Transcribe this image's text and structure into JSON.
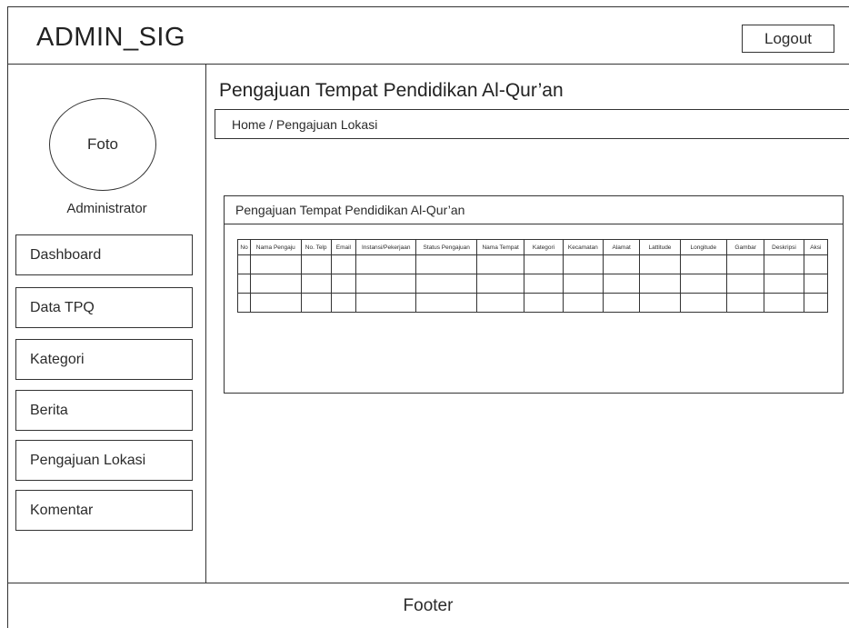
{
  "header": {
    "app_title": "ADMIN_SIG",
    "logout_label": "Logout"
  },
  "sidebar": {
    "avatar_label": "Foto",
    "role": "Administrator",
    "items": [
      {
        "label": "Dashboard"
      },
      {
        "label": "Data TPQ"
      },
      {
        "label": "Kategori"
      },
      {
        "label": "Berita"
      },
      {
        "label": "Pengajuan Lokasi"
      },
      {
        "label": "Komentar"
      }
    ]
  },
  "main": {
    "page_title": "Pengajuan Tempat Pendidikan Al-Qur’an",
    "breadcrumb": "Home / Pengajuan Lokasi",
    "panel_title": "Pengajuan Tempat Pendidikan Al-Qur’an",
    "table": {
      "columns": [
        "No",
        "Nama Pengaju",
        "No. Telp",
        "Email",
        "Instansi/Pekerjaan",
        "Status Pengajuan",
        "Nama Tempat",
        "Kategori",
        "Kecamatan",
        "Alamat",
        "Lattitude",
        "Longitude",
        "Gambar",
        "Deskripsi",
        "Aksi"
      ],
      "rows": [
        [
          "",
          "",
          "",
          "",
          "",
          "",
          "",
          "",
          "",
          "",
          "",
          "",
          "",
          "",
          ""
        ],
        [
          "",
          "",
          "",
          "",
          "",
          "",
          "",
          "",
          "",
          "",
          "",
          "",
          "",
          "",
          ""
        ],
        [
          "",
          "",
          "",
          "",
          "",
          "",
          "",
          "",
          "",
          "",
          "",
          "",
          "",
          "",
          ""
        ]
      ]
    }
  },
  "footer": {
    "label": "Footer"
  }
}
